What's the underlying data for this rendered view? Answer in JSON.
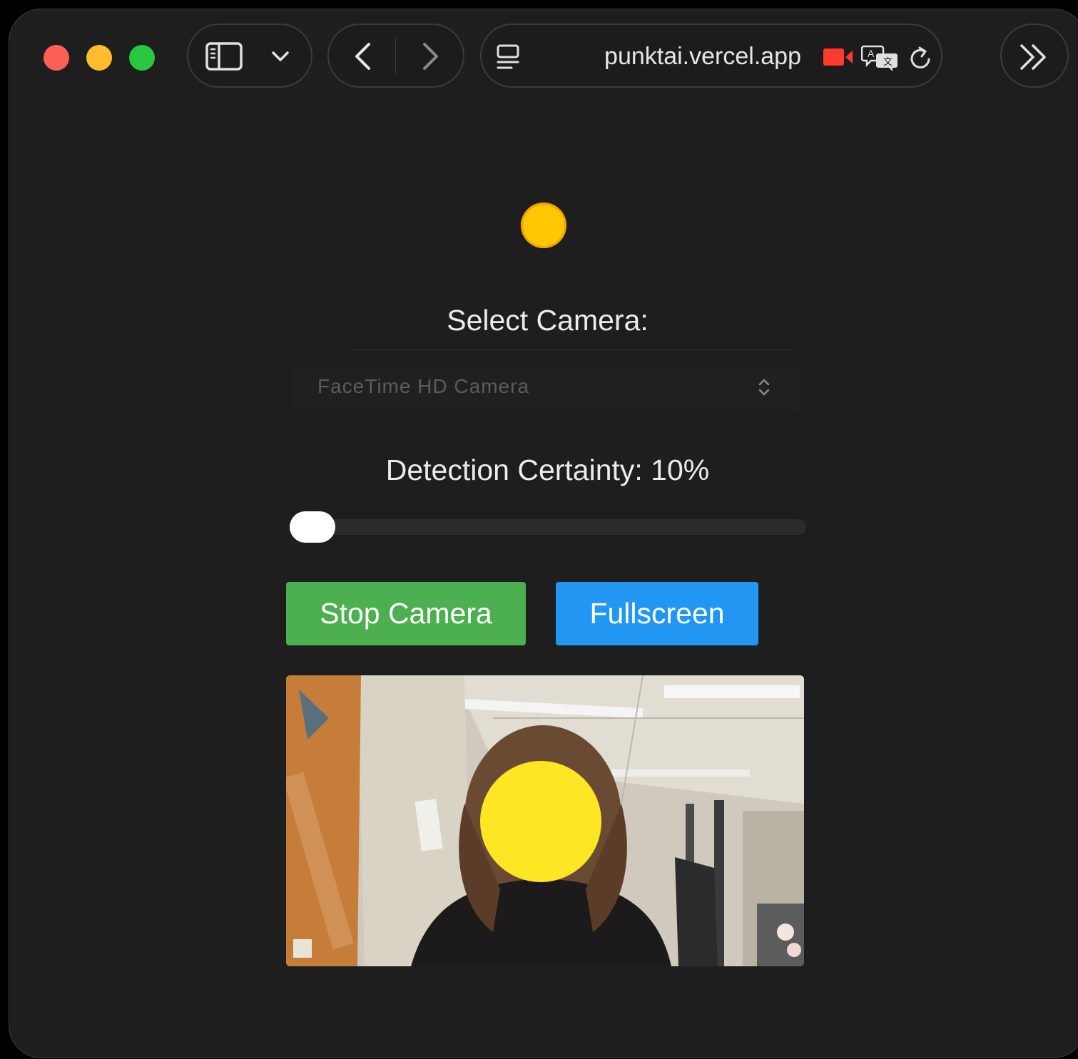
{
  "browser": {
    "address": "punktai.vercel.app",
    "icons": {
      "sidebar": "sidebar-icon",
      "chevron": "chevron-down-icon",
      "back": "back-arrow-icon",
      "forward": "forward-arrow-icon",
      "reader": "page-menu-icon",
      "camera": "camera-recording-icon",
      "translate": "translate-icon",
      "reload": "reload-icon",
      "more": "double-chevron-right-icon"
    },
    "colors": {
      "close": "#ff5f57",
      "minimize": "#febc2e",
      "zoom": "#28c840",
      "camera_indicator": "#ff3b30"
    }
  },
  "page": {
    "status_color": "#ffc800",
    "select_label": "Select Camera:",
    "camera_select": {
      "value": "FaceTime HD Camera"
    },
    "certainty_label": "Detection Certainty: 10%",
    "certainty_value": 10,
    "buttons": {
      "stop": "Stop Camera",
      "fullscreen": "Fullscreen"
    },
    "colors": {
      "stop_button": "#4caf50",
      "fullscreen_button": "#2196f3",
      "face_mask": "#fde724"
    }
  }
}
